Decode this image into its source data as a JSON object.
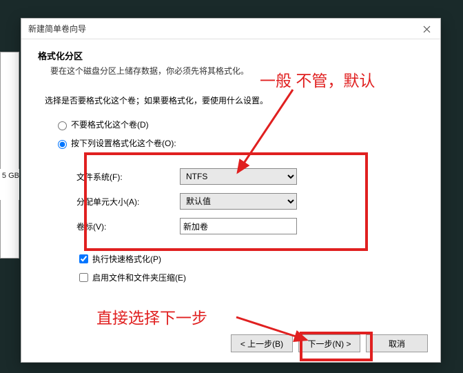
{
  "bg": {
    "disk_label": "5 GB"
  },
  "dialog": {
    "title": "新建简单卷向导",
    "heading": "格式化分区",
    "subheading": "要在这个磁盘分区上储存数据，你必须先将其格式化。",
    "prompt": "选择是否要格式化这个卷；如果要格式化，要使用什么设置。",
    "radio_none": "不要格式化这个卷(D)",
    "radio_settings": "按下列设置格式化这个卷(O):",
    "field_fs_label": "文件系统(F):",
    "field_fs_value": "NTFS",
    "field_au_label": "分配单元大小(A):",
    "field_au_value": "默认值",
    "field_vol_label": "卷标(V):",
    "field_vol_value": "新加卷",
    "chk_quick": "执行快速格式化(P)",
    "chk_compress": "启用文件和文件夹压缩(E)",
    "btn_back": "< 上一步(B)",
    "btn_next": "下一步(N) >",
    "btn_cancel": "取消"
  },
  "annotations": {
    "note1": "一般 不管，默认",
    "note2": "直接选择下一步"
  }
}
